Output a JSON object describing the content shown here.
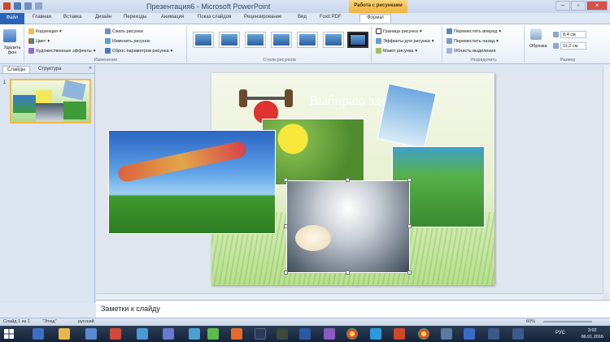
{
  "titlebar": {
    "title": "Презентация6 - Microsoft PowerPoint",
    "context_header": "Работа с рисунками"
  },
  "tabs": [
    "Файл",
    "Главная",
    "Вставка",
    "Дизайн",
    "Переходы",
    "Анимация",
    "Показ слайдов",
    "Рецензирование",
    "Вид",
    "Foxit PDF",
    "Формат"
  ],
  "ribbon": {
    "remove_bg": "Удалить фон",
    "adjust": {
      "correction": "Коррекция",
      "color": "Цвет",
      "artistic": "Художественные эффекты",
      "compress": "Сжать рисунки",
      "change": "Изменить рисунок",
      "reset": "Сброс параметров рисунка",
      "label": "Изменение"
    },
    "styles": {
      "label": "Стили рисунков"
    },
    "picture_opts": {
      "border": "Граница рисунка",
      "effects": "Эффекты для рисунка",
      "layout": "Макет рисунка"
    },
    "arrange": {
      "forward": "Переместить вперед",
      "backward": "Переместить назад",
      "selection": "Область выделения",
      "label": "Упорядочить"
    },
    "size": {
      "crop": "Обрезка",
      "height": "8,4 см",
      "width": "11,2 см",
      "label": "Размер"
    }
  },
  "leftpane": {
    "tab_slides": "Слайды",
    "tab_outline": "Структура",
    "close": "×",
    "slide_number": "1"
  },
  "slide": {
    "title": "Выбираю здоровье"
  },
  "notes": {
    "placeholder": "Заметки к слайду"
  },
  "status": {
    "slide": "Слайд 1 из 1",
    "theme": "\"Этюд\"",
    "language": "русский",
    "zoom": "60%"
  },
  "taskbar": {
    "lang": "РУС",
    "time": "3:02",
    "date": "06.01.2016"
  },
  "colors": {
    "file_tab": "#2a62b8",
    "context": "#f0b23c",
    "accent": "#2a62b8"
  }
}
